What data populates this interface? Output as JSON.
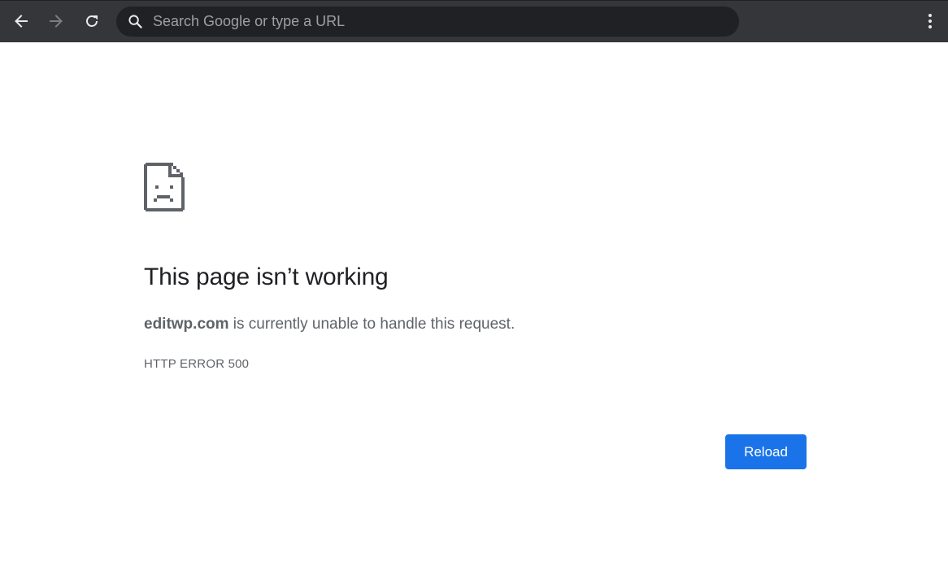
{
  "browser": {
    "omnibox": {
      "placeholder": "Search Google or type a URL",
      "value": ""
    },
    "icons": {
      "back": "back-arrow-icon",
      "forward": "forward-arrow-icon",
      "reload": "reload-icon",
      "search": "search-icon",
      "menu": "three-dot-menu-icon"
    },
    "colors": {
      "toolbar": "#35363a",
      "omnibox": "#202124"
    }
  },
  "error_page": {
    "icon": "sad-page-icon",
    "title": "This page isn’t working",
    "domain": "editwp.com",
    "message": " is currently unable to handle this request.",
    "error_code": "HTTP ERROR 500",
    "reload_label": "Reload",
    "colors": {
      "title": "#202124",
      "text": "#5f6368",
      "button": "#1a73e8"
    }
  }
}
